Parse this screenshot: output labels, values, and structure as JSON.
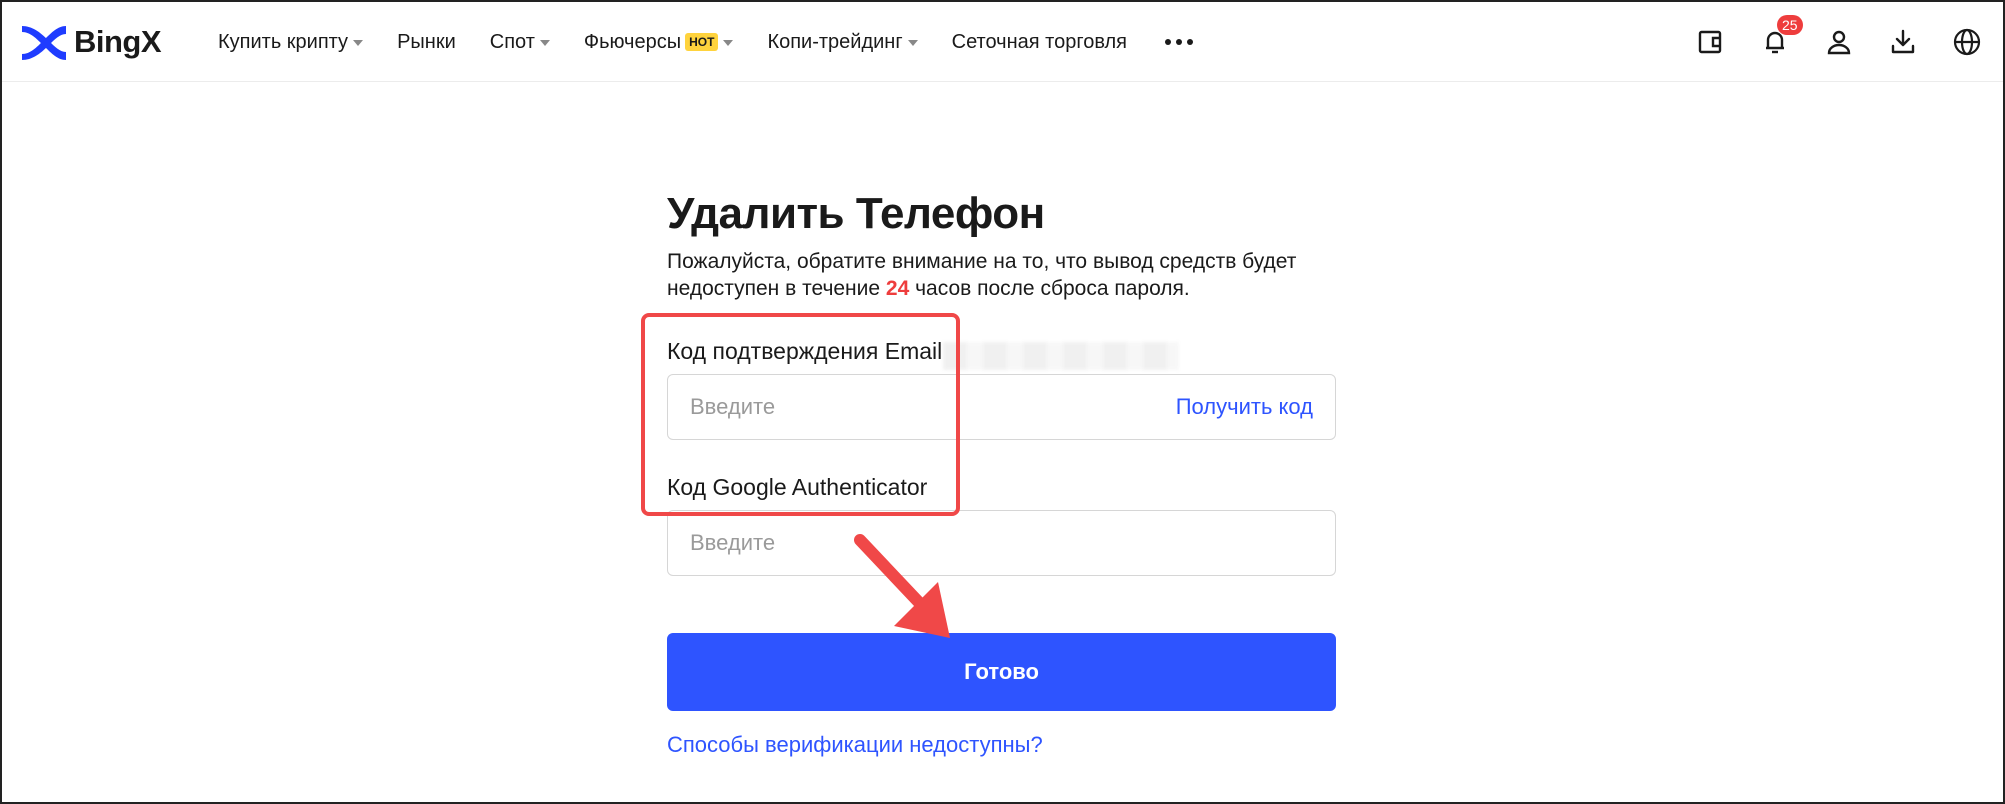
{
  "brand": {
    "name": "BingX",
    "color": "#1f3cff"
  },
  "nav": {
    "items": [
      {
        "label": "Купить крипту",
        "dropdown": true
      },
      {
        "label": "Рынки",
        "dropdown": false
      },
      {
        "label": "Спот",
        "dropdown": true
      },
      {
        "label": "Фьючерсы",
        "dropdown": true,
        "badge": "HOT"
      },
      {
        "label": "Копи-трейдинг",
        "dropdown": true
      },
      {
        "label": "Сеточная торговля",
        "dropdown": false
      }
    ],
    "more_icon": "more-horizontal-icon"
  },
  "header_icons": {
    "wallet": "wallet-icon",
    "notifications": {
      "icon": "bell-icon",
      "count": "25"
    },
    "profile": "user-icon",
    "download": "download-icon",
    "language": "globe-icon"
  },
  "form": {
    "title": "Удалить Телефон",
    "notice_before": "Пожалуйста, обратите внимание на то, что вывод средств будет недоступен в течение ",
    "notice_highlight": "24",
    "notice_after": " часов после сброса пароля.",
    "email_label": "Код подтверждения Email",
    "email_placeholder": "Введите",
    "get_code": "Получить код",
    "google_label": "Код Google Authenticator",
    "google_placeholder": "Введите",
    "submit": "Готово",
    "alt_link": "Способы верификации недоступны?"
  },
  "colors": {
    "accent": "#2e54ff",
    "highlight": "#ee3d3d",
    "annotation": "#f04848",
    "hot_badge": "#ffd33d"
  }
}
